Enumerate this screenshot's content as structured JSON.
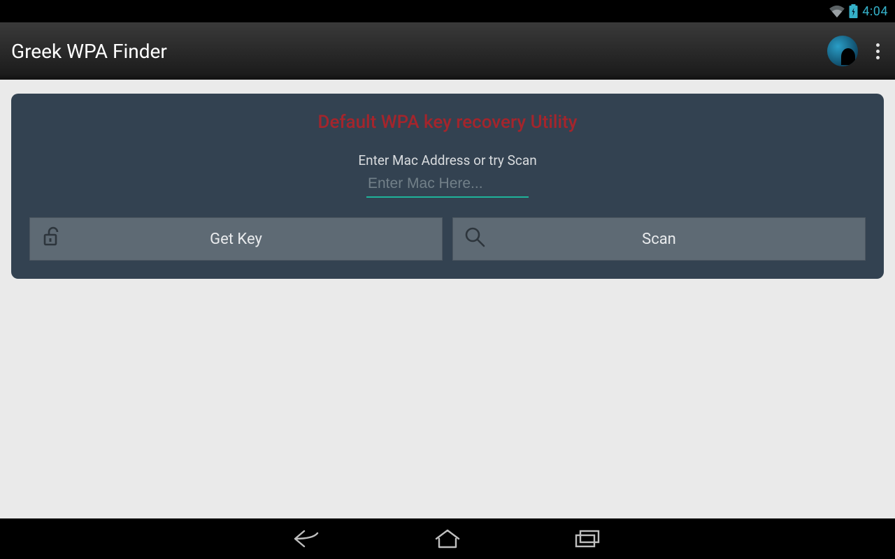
{
  "status": {
    "time": "4:04"
  },
  "appbar": {
    "title": "Greek WPA Finder"
  },
  "card": {
    "title": "Default WPA key recovery Utility",
    "prompt": "Enter Mac Address or try Scan",
    "input_placeholder": "Enter Mac Here...",
    "input_value": "",
    "get_key_label": "Get Key",
    "scan_label": "Scan"
  }
}
